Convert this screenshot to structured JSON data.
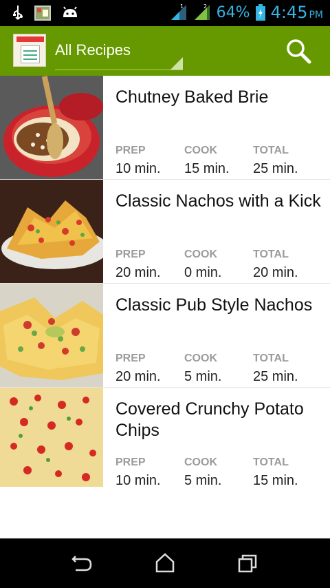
{
  "status_bar": {
    "battery_percent": "64%",
    "time": "4:45",
    "ampm": "PM",
    "icons": [
      "usb-icon",
      "photo-icon",
      "android-icon",
      "signal-1-icon",
      "signal-2-icon",
      "battery-icon"
    ]
  },
  "action_bar": {
    "spinner_selected": "All Recipes",
    "search_icon": "search-icon",
    "app_logo": "recipe-app-logo"
  },
  "recipes": [
    {
      "title": "Chutney Baked Brie",
      "prep_label": "PREP",
      "prep": "10 min.",
      "cook_label": "COOK",
      "cook": "15 min.",
      "total_label": "TOTAL",
      "total": "25 min."
    },
    {
      "title": "Classic Nachos with a Kick",
      "prep_label": "PREP",
      "prep": "20 min.",
      "cook_label": "COOK",
      "cook": "0 min.",
      "total_label": "TOTAL",
      "total": "20 min."
    },
    {
      "title": "Classic Pub Style Nachos",
      "prep_label": "PREP",
      "prep": "20 min.",
      "cook_label": "COOK",
      "cook": "5 min.",
      "total_label": "TOTAL",
      "total": "25 min."
    },
    {
      "title": "Covered Crunchy Potato Chips",
      "prep_label": "PREP",
      "prep": "10 min.",
      "cook_label": "COOK",
      "cook": "5 min.",
      "total_label": "TOTAL",
      "total": "15 min."
    }
  ],
  "nav_bar": {
    "icons": [
      "back-icon",
      "home-icon",
      "recent-apps-icon"
    ]
  },
  "colors": {
    "action_bar": "#669900",
    "status_accent": "#33b5e5",
    "stat_label": "#9b9b9b"
  }
}
